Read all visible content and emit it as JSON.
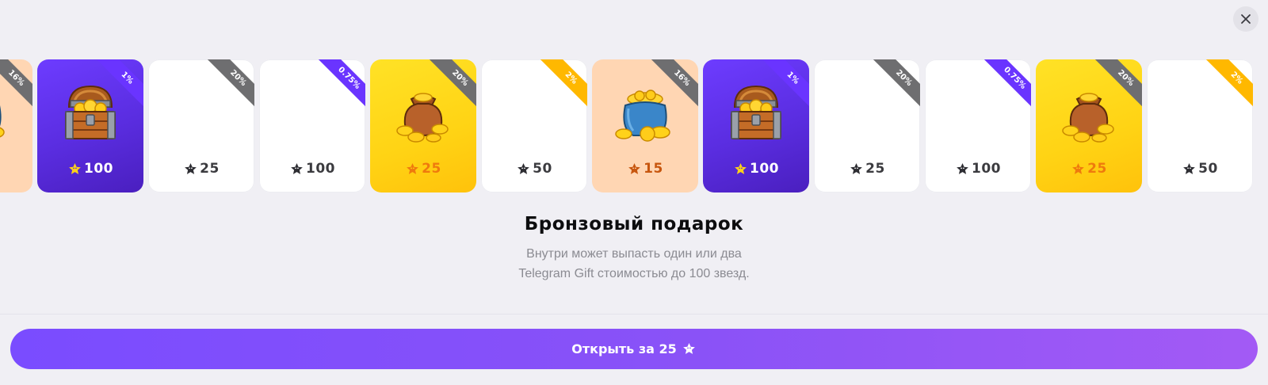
{
  "close_icon": "close-icon",
  "colors": {
    "purple": "#6d3cff",
    "yellow": "#ffd314",
    "peach": "#ffd6b3",
    "white": "#ffffff",
    "button_start": "#7a4cff",
    "button_end": "#a35af5"
  },
  "cards": [
    {
      "theme": "peach",
      "art": "coin-pot-icon",
      "price": "",
      "chance": "16%",
      "ribbon": "gray"
    },
    {
      "theme": "purple",
      "art": "treasure-chest-icon",
      "price": "100",
      "chance": "1%",
      "ribbon": "purple"
    },
    {
      "theme": "white",
      "art": "",
      "price": "25",
      "chance": "20%",
      "ribbon": "gray"
    },
    {
      "theme": "white",
      "art": "",
      "price": "100",
      "chance": "0.75%",
      "ribbon": "purple"
    },
    {
      "theme": "yellow",
      "art": "gold-sack-icon",
      "price": "25",
      "chance": "20%",
      "ribbon": "gray"
    },
    {
      "theme": "white",
      "art": "",
      "price": "50",
      "chance": "2%",
      "ribbon": "gold"
    },
    {
      "theme": "peach",
      "art": "coin-pot-icon",
      "price": "15",
      "chance": "16%",
      "ribbon": "gray"
    },
    {
      "theme": "purple",
      "art": "treasure-chest-icon",
      "price": "100",
      "chance": "1%",
      "ribbon": "purple"
    },
    {
      "theme": "white",
      "art": "",
      "price": "25",
      "chance": "20%",
      "ribbon": "gray"
    },
    {
      "theme": "white",
      "art": "",
      "price": "100",
      "chance": "0.75%",
      "ribbon": "purple"
    },
    {
      "theme": "yellow",
      "art": "gold-sack-icon",
      "price": "25",
      "chance": "20%",
      "ribbon": "gray"
    },
    {
      "theme": "white",
      "art": "",
      "price": "50",
      "chance": "2%",
      "ribbon": "gold"
    }
  ],
  "gift": {
    "title": "Бронзовый подарок",
    "description_line1": "Внутри может выпасть один или два",
    "description_line2": "Telegram Gift стоимостью до 100 звезд."
  },
  "open_button": {
    "label": "Открыть за 25",
    "icon": "star-icon"
  }
}
